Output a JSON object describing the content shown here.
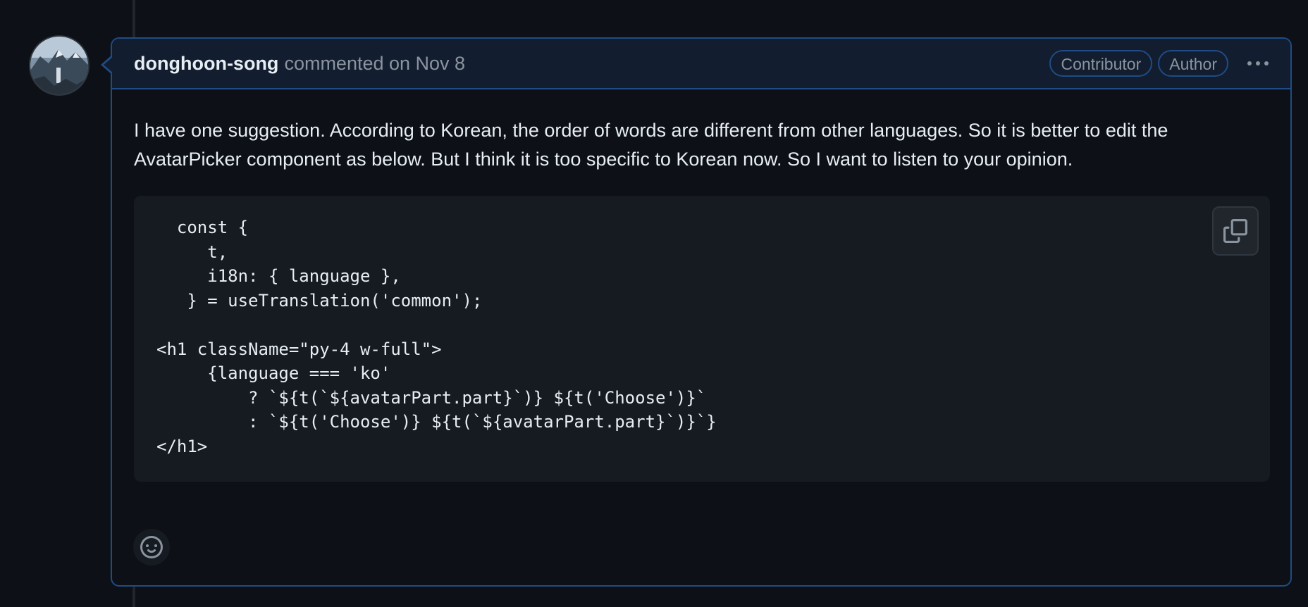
{
  "comment": {
    "author": "donghoon-song",
    "meta": "commented on Nov 8",
    "badges": [
      "Contributor",
      "Author"
    ],
    "body": "I have one suggestion. According to Korean, the order of words are different from other languages. So it is better to edit the AvatarPicker component as below. But I think it is too specific to Korean now. So I want to listen to your opinion.",
    "code": "  const {\n     t,\n     i18n: { language },\n   } = useTranslation('common');\n\n<h1 className=\"py-4 w-full\">\n     {language === 'ko'\n         ? `${t(`${avatarPart.part}`)} ${t('Choose')}`\n         : `${t('Choose')} ${t(`${avatarPart.part}`)}`}\n</h1>"
  },
  "icons": {
    "copy": "copy-icon",
    "more": "kebab-horizontal-icon",
    "reaction": "smiley-icon"
  },
  "colors": {
    "background": "#0d1117",
    "header_bg": "#121d2f",
    "border_accent": "#1f4c85",
    "muted_text": "#8b949e",
    "code_bg": "#161b22"
  }
}
